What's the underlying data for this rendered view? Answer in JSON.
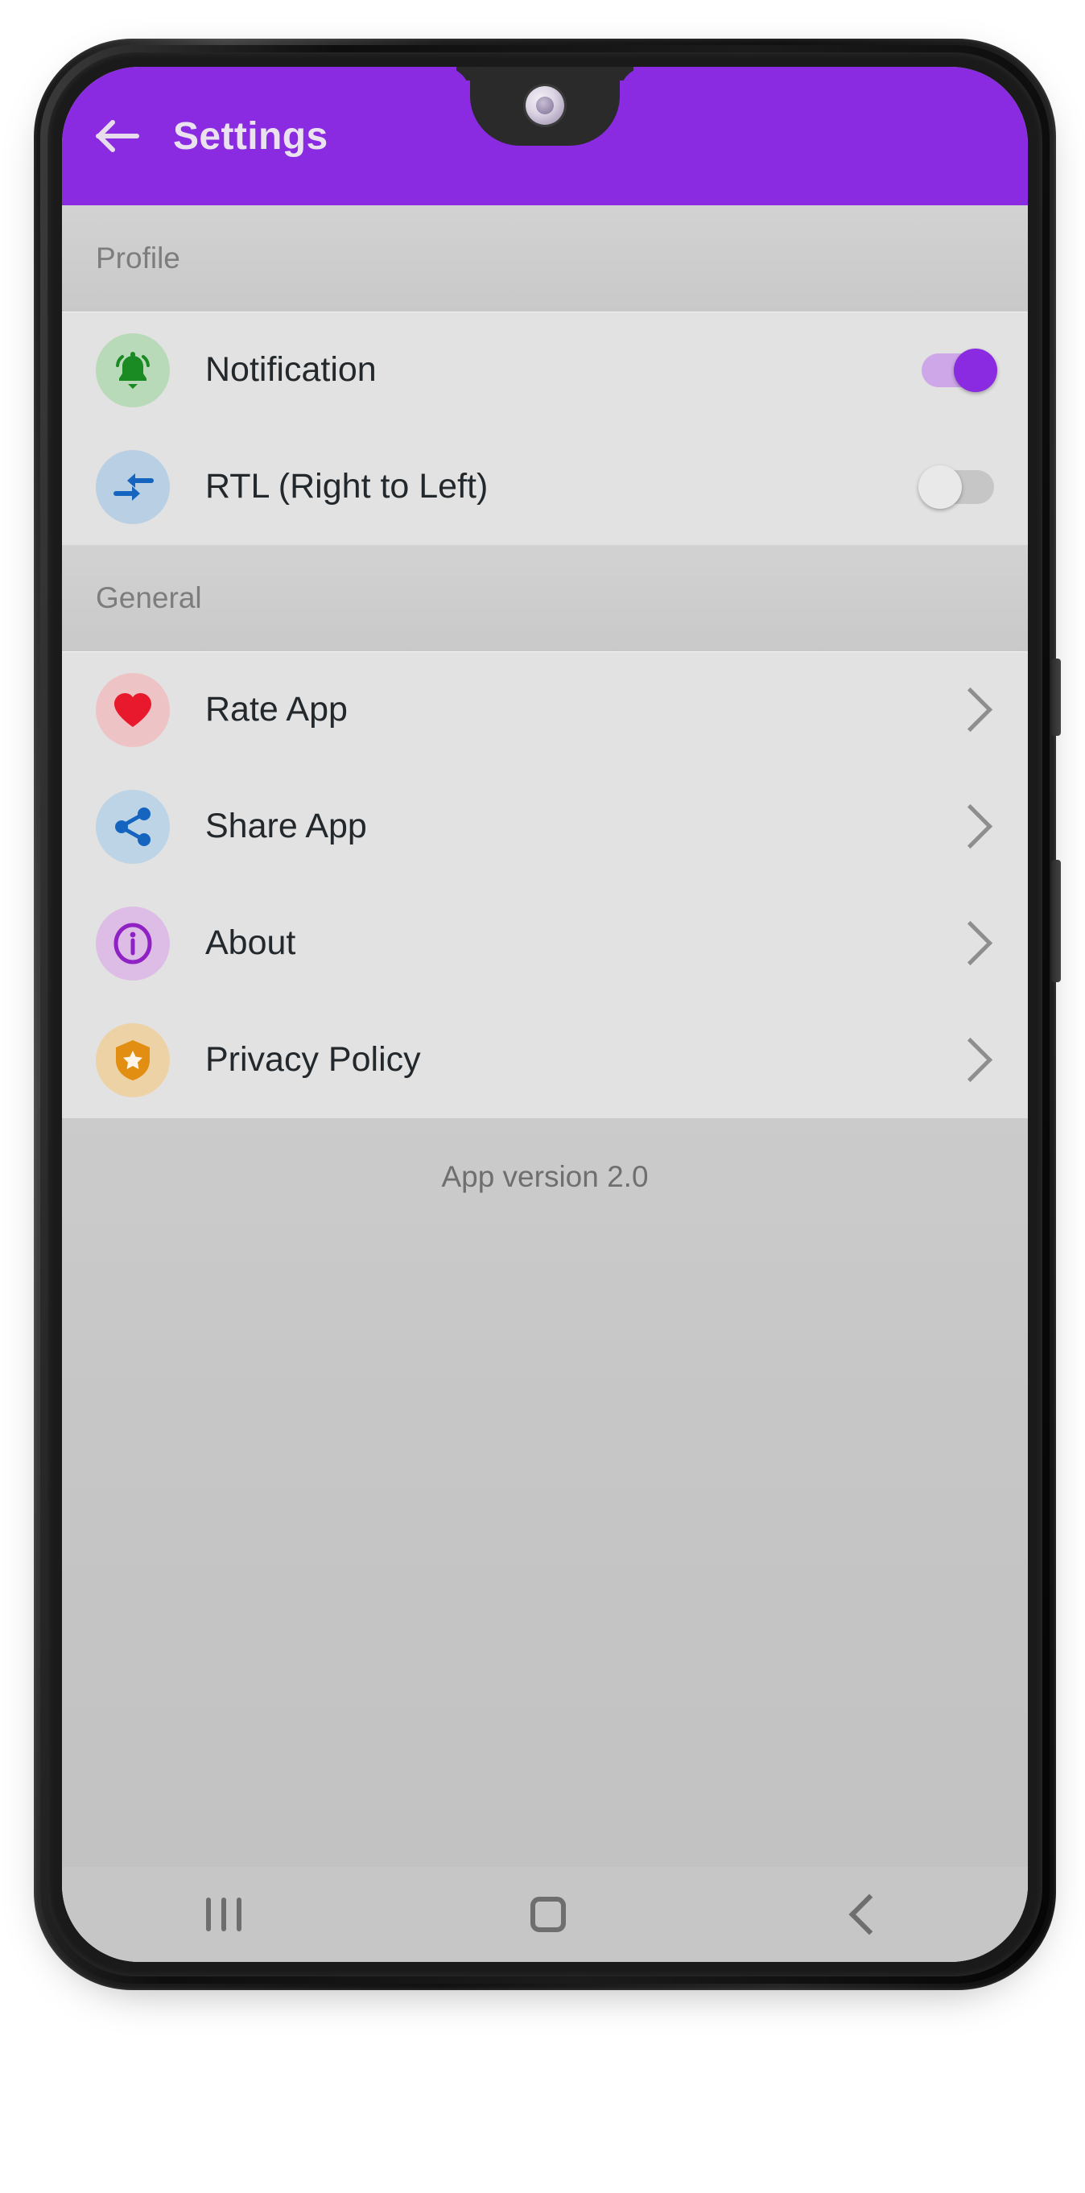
{
  "appbar": {
    "title": "Settings",
    "back_icon": "arrow-left-icon",
    "background": "#8A2BE2",
    "title_color": "#eae3ef"
  },
  "sections": [
    {
      "header": "Profile",
      "rows": [
        {
          "label": "Notification",
          "icon": "bell-icon",
          "icon_color": "#1a8a23",
          "icon_bg": "#b9dab8",
          "control": "toggle",
          "toggle_state": "on"
        },
        {
          "label": "RTL (Right to Left)",
          "icon": "bidirectional-arrows-icon",
          "icon_color": "#1565C0",
          "icon_bg": "#b9cfe4",
          "control": "toggle",
          "toggle_state": "off"
        }
      ]
    },
    {
      "header": "General",
      "rows": [
        {
          "label": "Rate App",
          "icon": "heart-icon",
          "icon_color": "#e8192c",
          "icon_bg": "#eec3c6",
          "control": "chevron"
        },
        {
          "label": "Share App",
          "icon": "share-icon",
          "icon_color": "#1565C0",
          "icon_bg": "#bcd4e6",
          "control": "chevron"
        },
        {
          "label": "About",
          "icon": "info-icon",
          "icon_color": "#9021c4",
          "icon_bg": "#ddbde6",
          "control": "chevron"
        },
        {
          "label": "Privacy Policy",
          "icon": "shield-star-icon",
          "icon_color": "#e28e13",
          "icon_bg": "#edd2a5",
          "control": "chevron"
        }
      ]
    }
  ],
  "footer": {
    "version_text": "App version 2.0"
  },
  "navbar": {
    "recents_icon": "recents-icon",
    "home_icon": "home-icon",
    "back_icon": "back-chevron-icon"
  },
  "device": {
    "camera_icon": "front-camera-icon",
    "earpiece_icon": "earpiece-speaker-icon"
  }
}
